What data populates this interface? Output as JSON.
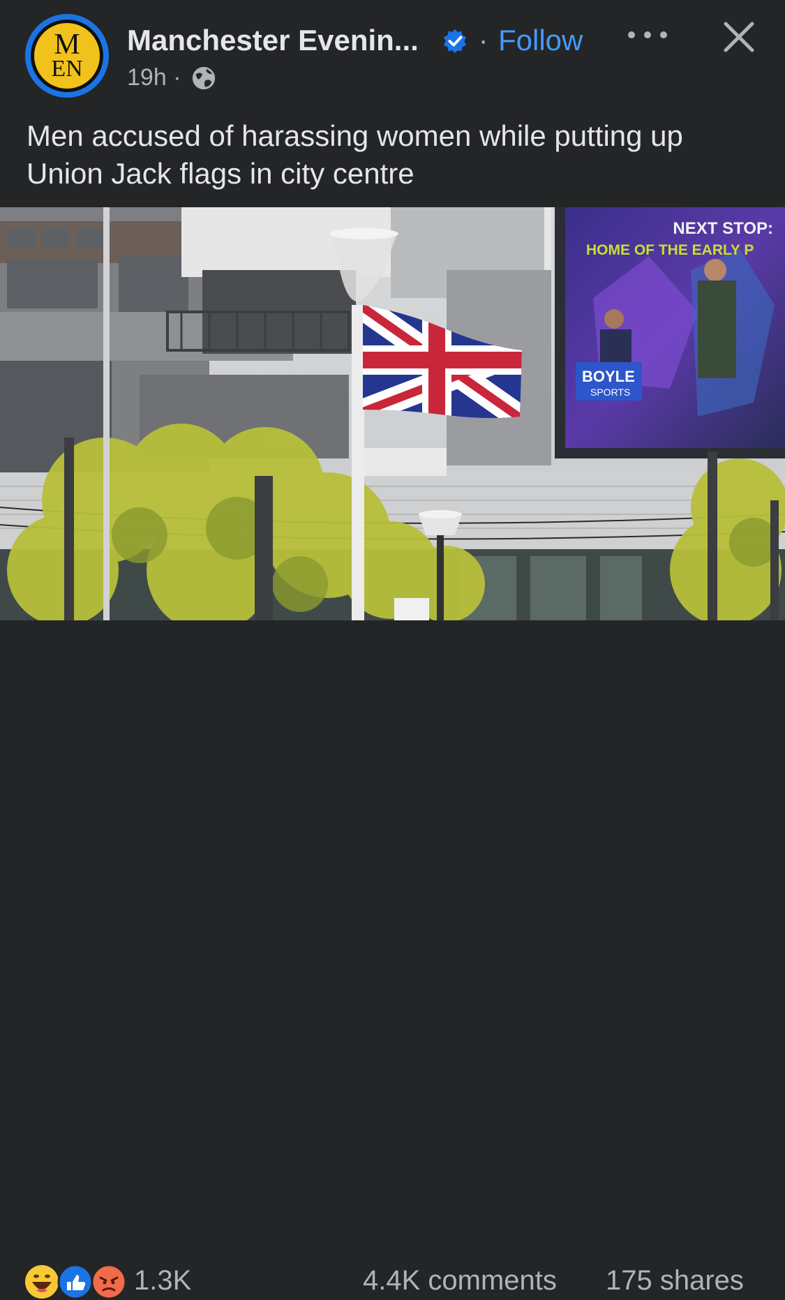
{
  "post": {
    "page_name": "Manchester Evenin...",
    "separator": "·",
    "follow_label": "Follow",
    "time": "19h ·",
    "avatar_text": [
      "M",
      "EN"
    ],
    "caption": "Men accused of harassing women while putting up Union Jack flags in city centre"
  },
  "photo": {
    "billboard_line1": "NEXT STOP:",
    "billboard_line2": "HOME OF THE EARLY P",
    "billboard_brand1": "BOYLE",
    "billboard_brand2": "SPORTS"
  },
  "footer": {
    "reaction_count": "1.3K",
    "comments": "4.4K comments",
    "shares": "175 shares",
    "reaction_icons": [
      "haha-icon",
      "like-icon",
      "angry-icon"
    ]
  },
  "colors": {
    "background": "#242526",
    "accent": "#4599ff",
    "verified": "#1b74e4",
    "logo": "#f1c21b"
  }
}
